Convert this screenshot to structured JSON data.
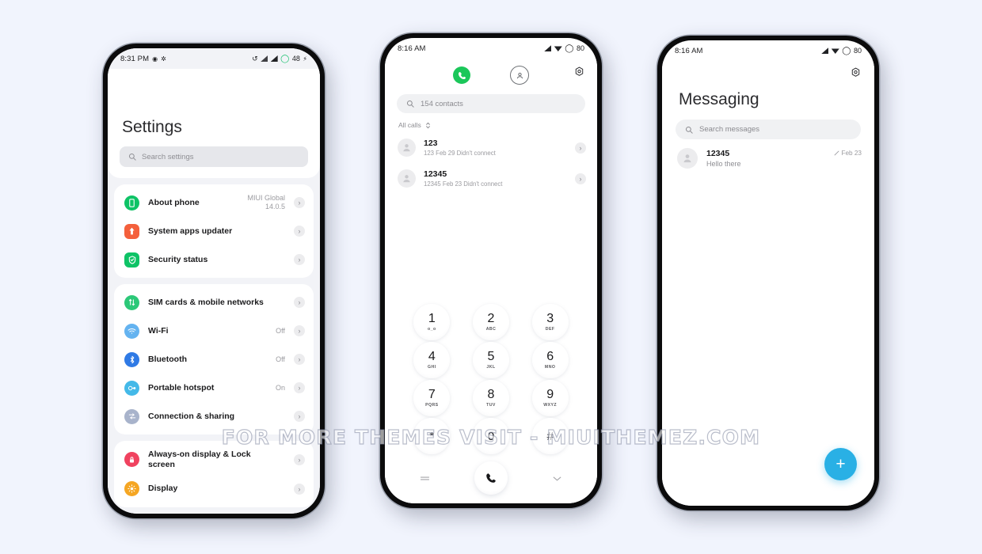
{
  "watermark": "FOR MORE THEMES VISIT - MIUITHEMEZ.COM",
  "colors": {
    "page_background": "#f1f4fd",
    "accent_fab": "#29b0e5",
    "dialer_active": "#1bc75a"
  },
  "phone1": {
    "status": {
      "time": "8:31 PM",
      "battery": "48",
      "icons": [
        "sync-icon",
        "alarm-icon",
        "vpn-icon",
        "signal-icon",
        "signal-icon",
        "battery-icon",
        "charging-bolt-icon"
      ]
    },
    "title": "Settings",
    "search_placeholder": "Search settings",
    "groups": [
      {
        "items": [
          {
            "label": "About\nphone",
            "value": "MIUI Global\n14.0.5",
            "icon": "phone-icon",
            "color": "#0ec366",
            "shape": "circle",
            "glyph": "▯"
          },
          {
            "label": "System apps updater",
            "value": "",
            "icon": "upload-arrow-icon",
            "color": "#f4603c",
            "shape": "square",
            "glyph": "↑"
          },
          {
            "label": "Security status",
            "value": "",
            "icon": "shield-check-icon",
            "color": "#0ec366",
            "shape": "square",
            "glyph": "✓"
          }
        ]
      },
      {
        "items": [
          {
            "label": "SIM cards & mobile\nnetworks",
            "value": "",
            "icon": "sim-card-icon",
            "color": "#2cc878",
            "shape": "circle",
            "glyph": "⇅"
          },
          {
            "label": "Wi-Fi",
            "value": "Off",
            "icon": "wifi-icon",
            "color": "#64b3f0",
            "shape": "circle",
            "glyph": "◗"
          },
          {
            "label": "Bluetooth",
            "value": "Off",
            "icon": "bluetooth-icon",
            "color": "#2f7ae5",
            "shape": "circle",
            "glyph": "✶"
          },
          {
            "label": "Portable hotspot",
            "value": "On",
            "icon": "hotspot-icon",
            "color": "#44b9e8",
            "shape": "circle",
            "glyph": "∞"
          },
          {
            "label": "Connection & sharing",
            "value": "",
            "icon": "connection-sharing-icon",
            "color": "#a8b3cb",
            "shape": "circle",
            "glyph": "⇄"
          }
        ]
      },
      {
        "items": [
          {
            "label": "Always-on display & Lock\nscreen",
            "value": "",
            "icon": "lock-icon",
            "color": "#f0425f",
            "shape": "circle",
            "glyph": "🔒"
          },
          {
            "label": "Display",
            "value": "",
            "icon": "brightness-icon",
            "color": "#f5a623",
            "shape": "circle",
            "glyph": "☀"
          }
        ]
      }
    ]
  },
  "phone2": {
    "status": {
      "time": "8:16 AM",
      "battery": "80",
      "icons": [
        "signal-icon",
        "wifi-icon",
        "battery-icon"
      ]
    },
    "tabs": [
      {
        "name": "dialer-tab",
        "icon": "phone-handset-icon",
        "active": true
      },
      {
        "name": "contacts-tab",
        "icon": "person-circle-icon",
        "active": false
      }
    ],
    "settings_icon": "gear-icon",
    "search_placeholder": "154 contacts",
    "filter_label": "All calls",
    "calls": [
      {
        "name": "123",
        "detail": "123  Feb 29  Didn't connect"
      },
      {
        "name": "12345",
        "detail": "12345  Feb 23  Didn't connect"
      }
    ],
    "keypad": [
      {
        "digit": "1",
        "sub": "o_o"
      },
      {
        "digit": "2",
        "sub": "ABC"
      },
      {
        "digit": "3",
        "sub": "DEF"
      },
      {
        "digit": "4",
        "sub": "GHI"
      },
      {
        "digit": "5",
        "sub": "JKL"
      },
      {
        "digit": "6",
        "sub": "MNO"
      },
      {
        "digit": "7",
        "sub": "PQRS"
      },
      {
        "digit": "8",
        "sub": "TUV"
      },
      {
        "digit": "9",
        "sub": "WXYZ"
      },
      {
        "digit": "*",
        "sub": ""
      },
      {
        "digit": "0",
        "sub": "+"
      },
      {
        "digit": "#",
        "sub": ""
      }
    ],
    "actions": {
      "left_icon": "menu-icon",
      "call_icon": "phone-handset-icon",
      "right_icon": "chevron-down-icon"
    }
  },
  "phone3": {
    "status": {
      "time": "8:16 AM",
      "battery": "80",
      "icons": [
        "signal-icon",
        "wifi-icon",
        "battery-icon"
      ]
    },
    "settings_icon": "gear-icon",
    "title": "Messaging",
    "search_placeholder": "Search messages",
    "threads": [
      {
        "name": "12345",
        "preview": "Hello there",
        "date": "Feb 23",
        "status_icon": "sent-icon"
      }
    ],
    "fab_icon": "plus-icon"
  }
}
